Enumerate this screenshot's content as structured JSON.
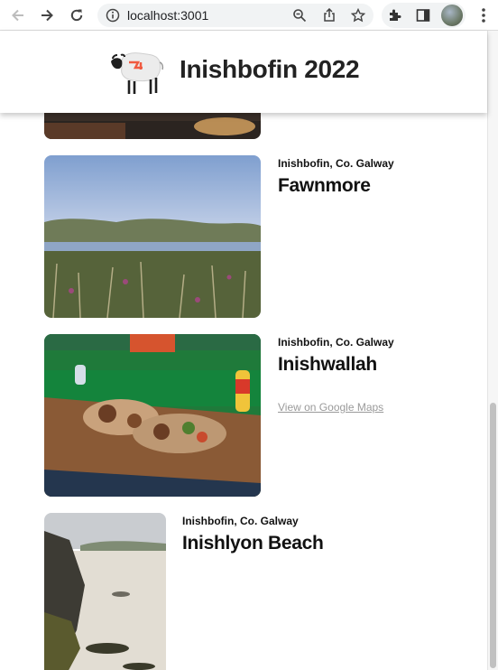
{
  "browser": {
    "url": "localhost:3001",
    "icons": [
      "back-arrow-icon",
      "forward-arrow-icon",
      "reload-icon",
      "info-icon",
      "zoom-icon",
      "share-icon",
      "bookmark-star-icon",
      "extensions-icon",
      "side-panel-icon",
      "profile-avatar",
      "more-menu-icon"
    ]
  },
  "header": {
    "title": "Inishbofin 2022",
    "logo": "sheep-logo"
  },
  "places": [
    {
      "location": "",
      "name": ""
    },
    {
      "location": "Inishbofin, Co. Galway",
      "name": "Fawnmore"
    },
    {
      "location": "Inishbofin, Co. Galway",
      "name": "Inishwallah",
      "link": "View on Google Maps"
    },
    {
      "location": "Inishbofin, Co. Galway",
      "name": "Inishlyon Beach"
    }
  ],
  "colors": {
    "link": "#9a9a9a",
    "text": "#111111"
  }
}
